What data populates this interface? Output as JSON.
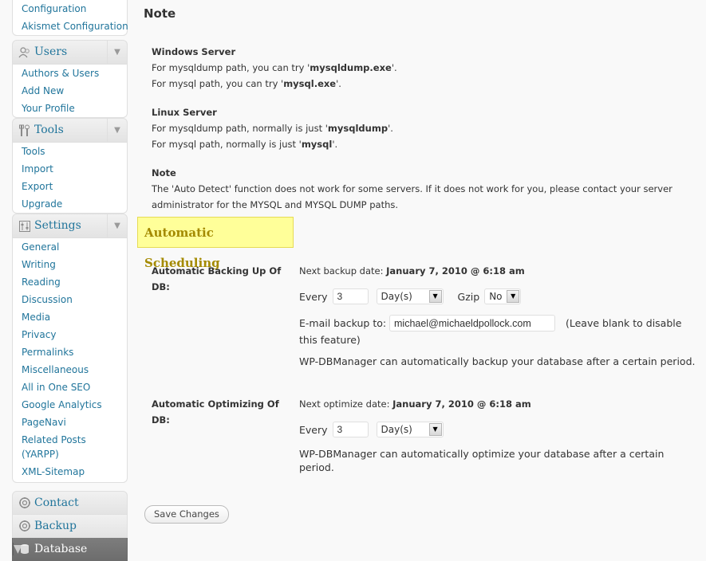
{
  "sidebar": {
    "top_items": [
      "Configuration",
      "Akismet Configuration"
    ],
    "users": {
      "label": "Users",
      "items": [
        "Authors & Users",
        "Add New",
        "Your Profile"
      ]
    },
    "tools": {
      "label": "Tools",
      "items": [
        "Tools",
        "Import",
        "Export",
        "Upgrade"
      ]
    },
    "settings": {
      "label": "Settings",
      "items": [
        "General",
        "Writing",
        "Reading",
        "Discussion",
        "Media",
        "Privacy",
        "Permalinks",
        "Miscellaneous",
        "All in One SEO",
        "Google Analytics",
        "PageNavi",
        "Related Posts (YARPP)",
        "XML-Sitemap"
      ]
    },
    "contact": "Contact",
    "backup": "Backup",
    "database": "Database",
    "collapse_arrow": "▼"
  },
  "note": {
    "title": "Note",
    "windows": {
      "heading": "Windows Server",
      "dump_prefix": "For mysqldump path, you can try '",
      "dump_value": "mysqldump.exe",
      "dump_suffix": "'.",
      "mysql_prefix": "For mysql path, you can try '",
      "mysql_value": "mysql.exe",
      "mysql_suffix": "'."
    },
    "linux": {
      "heading": "Linux Server",
      "dump_prefix": "For mysqldump path, normally is just '",
      "dump_value": "mysqldump",
      "dump_suffix": "'.",
      "mysql_prefix": "For mysql path, normally is just '",
      "mysql_value": "mysql",
      "mysql_suffix": "'."
    },
    "auto": {
      "heading": "Note",
      "line1": "The 'Auto Detect' function does not work for some servers. If it does not work for you, please contact your server",
      "line2": "administrator for the MYSQL and MYSQL DUMP paths."
    }
  },
  "scheduling": {
    "heading": "Automatic Scheduling",
    "backup": {
      "label_line1": "Automatic Backing Up Of",
      "label_line2": "DB:",
      "next_label": "Next backup date: ",
      "next_value": "January 7, 2010 @ 6:18 am",
      "every_label": "Every",
      "every_value": "3",
      "unit_value": "Day(s)",
      "gzip_label": "Gzip",
      "gzip_value": "No",
      "email_label": "E-mail backup to:",
      "email_value": "michael@michaeldpollock.com",
      "email_hint1": "(Leave blank to disable",
      "email_hint2": "this feature)",
      "desc": "WP-DBManager can automatically backup your database after a certain period."
    },
    "optimize": {
      "label_line1": "Automatic Optimizing Of",
      "label_line2": "DB:",
      "next_label": "Next optimize date: ",
      "next_value": "January 7, 2010 @ 6:18 am",
      "every_label": "Every",
      "every_value": "3",
      "unit_value": "Day(s)",
      "desc1": "WP-DBManager can automatically optimize your database after a certain",
      "desc2": "period."
    }
  },
  "save_label": "Save Changes"
}
